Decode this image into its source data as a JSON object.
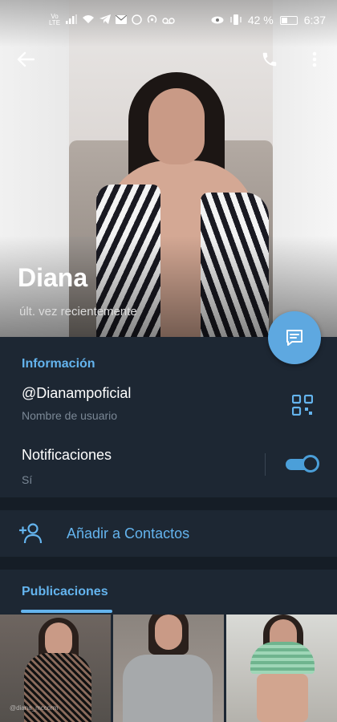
{
  "status_bar": {
    "volte": "Vo LTE",
    "signal_icon": "signal-icon",
    "battery_percent": "42 %",
    "battery_level": 0.42,
    "time": "6:37"
  },
  "profile": {
    "name": "Diana",
    "last_seen": "últ. vez recientemente"
  },
  "info": {
    "section_title": "Información",
    "username": "@Dianampoficial",
    "username_label": "Nombre de usuario",
    "notifications_label": "Notificaciones",
    "notifications_value": "Sí",
    "notifications_on": true
  },
  "actions": {
    "add_contact": "Añadir a Contactos"
  },
  "posts": {
    "section_title": "Publicaciones",
    "thumbnails": [
      {
        "label": "@diana_mccorm"
      },
      {
        "label": ""
      },
      {
        "label": ""
      }
    ]
  },
  "colors": {
    "background": "#1d2733",
    "accent": "#64b4ee",
    "fab": "#5ea8e0",
    "separator": "#151d26"
  }
}
